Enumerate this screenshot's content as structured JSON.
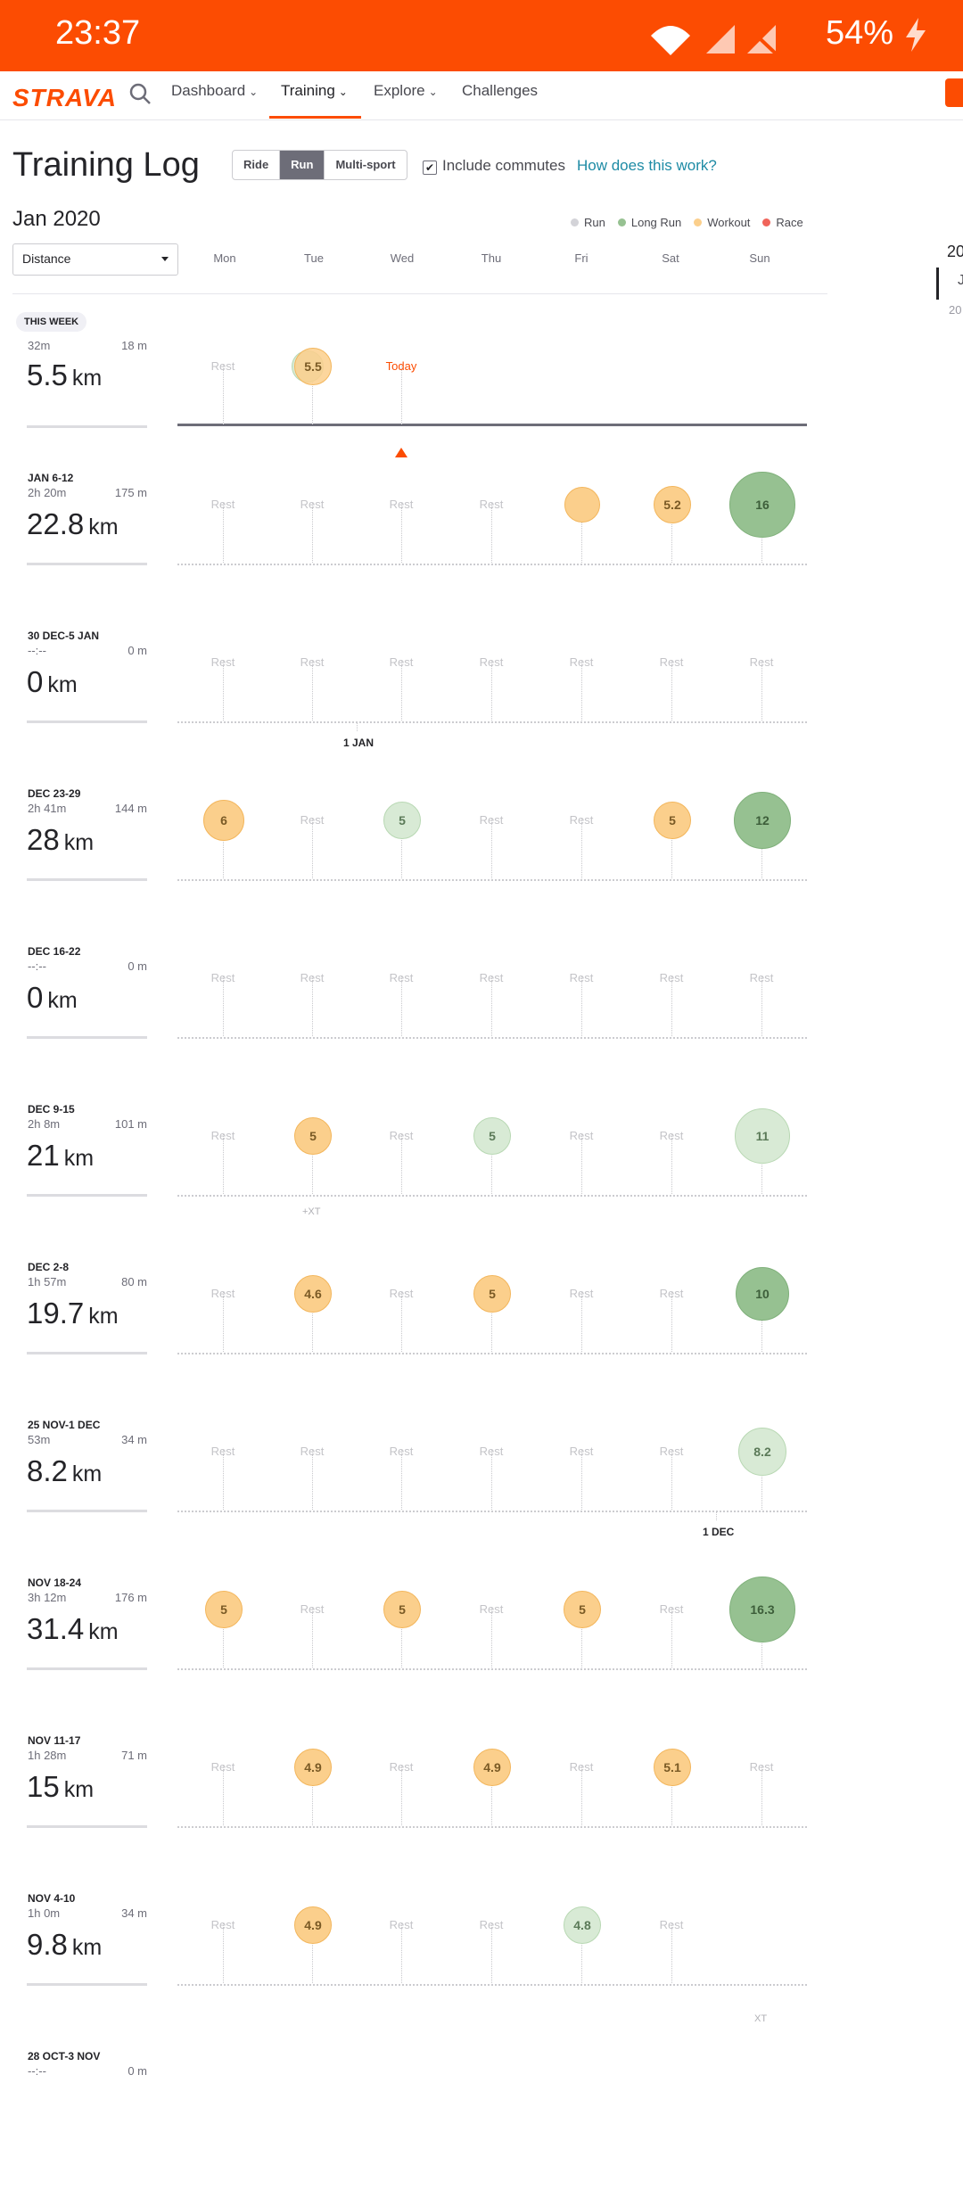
{
  "status": {
    "time": "23:37",
    "battery": "54%"
  },
  "nav": {
    "logo": "STRAVA",
    "items": [
      {
        "label": "Dashboard",
        "chevron": "⌄"
      },
      {
        "label": "Training",
        "chevron": "⌄"
      },
      {
        "label": "Explore",
        "chevron": "⌄"
      },
      {
        "label": "Challenges"
      }
    ]
  },
  "page": {
    "title": "Training Log",
    "sports": [
      "Ride",
      "Run",
      "Multi-sport"
    ],
    "selected_sport": "Run",
    "commute_label": "Include commutes",
    "commute_checked": "✔",
    "how_link": "How does this work?",
    "month": "Jan 2020",
    "metric_select": "Distance"
  },
  "legend": [
    {
      "label": "Run",
      "color": "#d3d3d8"
    },
    {
      "label": "Long Run",
      "color": "#96c191"
    },
    {
      "label": "Workout",
      "color": "#fbcf8c"
    },
    {
      "label": "Race",
      "color": "#f0645a"
    }
  ],
  "days": [
    "Mon",
    "Tue",
    "Wed",
    "Thu",
    "Fri",
    "Sat",
    "Sun"
  ],
  "side": {
    "year": "20",
    "month_initial": "J",
    "prev": "20"
  },
  "rest_label": "Rest",
  "today_label": "Today",
  "weeks": [
    {
      "label": "THIS WEEK",
      "time": "32m",
      "elev": "18 m",
      "dist": "5.5",
      "unit": "km",
      "days": [
        {
          "rest": true
        },
        {
          "type": "workout",
          "value": "5.5",
          "also": "run"
        },
        {
          "today": true
        },
        {
          "empty": true
        },
        {
          "empty": true
        },
        {
          "empty": true
        },
        {
          "empty": true
        }
      ]
    },
    {
      "label": "JAN 6-12",
      "time": "2h 20m",
      "elev": "175 m",
      "dist": "22.8",
      "unit": "km",
      "days": [
        {
          "rest": true
        },
        {
          "rest": true
        },
        {
          "rest": true
        },
        {
          "rest": true
        },
        {
          "type": "workout",
          "value": ""
        },
        {
          "type": "workout",
          "value": "5.2"
        },
        {
          "type": "long",
          "value": "16"
        }
      ]
    },
    {
      "label": "30 DEC-5 JAN",
      "time": "--:--",
      "elev": "0 m",
      "dist": "0",
      "unit": "km",
      "days": [
        {
          "rest": true
        },
        {
          "rest": true
        },
        {
          "rest": true
        },
        {
          "rest": true
        },
        {
          "rest": true
        },
        {
          "rest": true
        },
        {
          "rest": true
        }
      ],
      "marker": "1 JAN"
    },
    {
      "label": "DEC 23-29",
      "time": "2h 41m",
      "elev": "144 m",
      "dist": "28",
      "unit": "km",
      "days": [
        {
          "type": "workout",
          "value": "6"
        },
        {
          "rest": true
        },
        {
          "type": "run",
          "value": "5"
        },
        {
          "rest": true
        },
        {
          "rest": true
        },
        {
          "type": "workout",
          "value": "5"
        },
        {
          "type": "long",
          "value": "12"
        }
      ]
    },
    {
      "label": "DEC 16-22",
      "time": "--:--",
      "elev": "0 m",
      "dist": "0",
      "unit": "km",
      "days": [
        {
          "rest": true
        },
        {
          "rest": true
        },
        {
          "rest": true
        },
        {
          "rest": true
        },
        {
          "rest": true
        },
        {
          "rest": true
        },
        {
          "rest": true
        }
      ]
    },
    {
      "label": "DEC 9-15",
      "time": "2h 8m",
      "elev": "101 m",
      "dist": "21",
      "unit": "km",
      "days": [
        {
          "rest": true
        },
        {
          "type": "workout",
          "value": "5",
          "xt": "+XT"
        },
        {
          "rest": true
        },
        {
          "type": "run",
          "value": "5"
        },
        {
          "rest": true
        },
        {
          "rest": true
        },
        {
          "type": "run",
          "value": "11"
        }
      ]
    },
    {
      "label": "DEC 2-8",
      "time": "1h 57m",
      "elev": "80 m",
      "dist": "19.7",
      "unit": "km",
      "days": [
        {
          "rest": true
        },
        {
          "type": "workout",
          "value": "4.6"
        },
        {
          "rest": true
        },
        {
          "type": "workout",
          "value": "5"
        },
        {
          "rest": true
        },
        {
          "rest": true
        },
        {
          "type": "long",
          "value": "10"
        }
      ]
    },
    {
      "label": "25 NOV-1 DEC",
      "time": "53m",
      "elev": "34 m",
      "dist": "8.2",
      "unit": "km",
      "days": [
        {
          "rest": true
        },
        {
          "rest": true
        },
        {
          "rest": true
        },
        {
          "rest": true
        },
        {
          "rest": true
        },
        {
          "rest": true
        },
        {
          "type": "run",
          "value": "8.2"
        }
      ],
      "marker": "1 DEC"
    },
    {
      "label": "NOV 18-24",
      "time": "3h 12m",
      "elev": "176 m",
      "dist": "31.4",
      "unit": "km",
      "days": [
        {
          "type": "workout",
          "value": "5"
        },
        {
          "rest": true
        },
        {
          "type": "workout",
          "value": "5"
        },
        {
          "rest": true
        },
        {
          "type": "workout",
          "value": "5"
        },
        {
          "rest": true
        },
        {
          "type": "long",
          "value": "16.3"
        }
      ]
    },
    {
      "label": "NOV 11-17",
      "time": "1h 28m",
      "elev": "71 m",
      "dist": "15",
      "unit": "km",
      "days": [
        {
          "rest": true
        },
        {
          "type": "workout",
          "value": "4.9"
        },
        {
          "rest": true
        },
        {
          "type": "workout",
          "value": "4.9"
        },
        {
          "rest": true
        },
        {
          "type": "workout",
          "value": "5.1"
        },
        {
          "rest": true
        }
      ]
    },
    {
      "label": "NOV 4-10",
      "time": "1h 0m",
      "elev": "34 m",
      "dist": "9.8",
      "unit": "km",
      "days": [
        {
          "rest": true
        },
        {
          "type": "workout",
          "value": "4.9"
        },
        {
          "rest": true
        },
        {
          "rest": true
        },
        {
          "type": "run",
          "value": "4.8"
        },
        {
          "rest": true
        },
        {
          "xtonly": "XT"
        }
      ]
    },
    {
      "label": "28 OCT-3 NOV",
      "time": "--:--",
      "elev": "0 m",
      "dist": "",
      "unit": "",
      "days": []
    }
  ]
}
